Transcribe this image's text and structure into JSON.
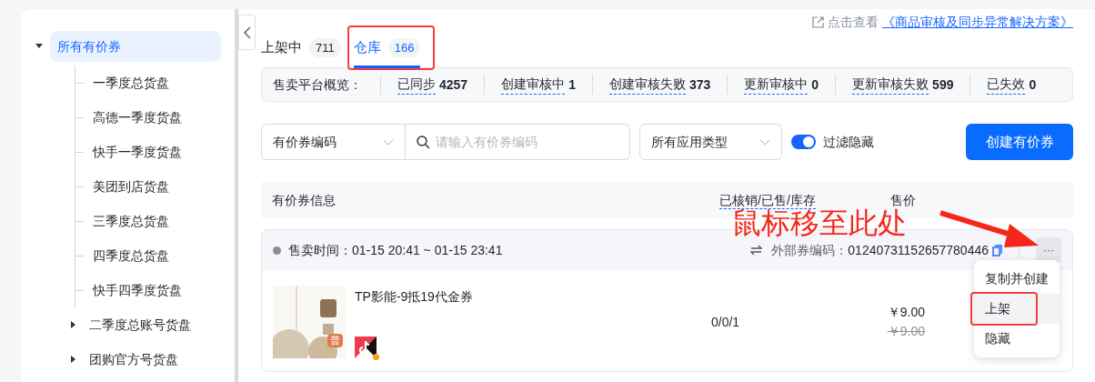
{
  "sidebar": {
    "tree": [
      {
        "label": "所有有价券",
        "selected": true,
        "expanded": true,
        "children": [
          {
            "label": "一季度总货盘",
            "selected": false
          },
          {
            "label": "高德一季度货盘",
            "selected": false
          },
          {
            "label": "快手一季度货盘",
            "selected": false
          },
          {
            "label": "美团到店货盘",
            "selected": false
          },
          {
            "label": "三季度总货盘",
            "selected": false
          },
          {
            "label": "四季度总货盘",
            "selected": false
          },
          {
            "label": "快手四季度货盘",
            "selected": false
          },
          {
            "label": "二季度总账号货盘",
            "selected": false,
            "expanded": false
          },
          {
            "label": "团购官方号货盘",
            "selected": false,
            "expanded": false
          }
        ]
      }
    ]
  },
  "tabs": [
    {
      "label": "上架中",
      "count": "711",
      "selected": false
    },
    {
      "label": "仓库",
      "count": "166",
      "selected": true
    }
  ],
  "help_link": {
    "prefix": "点击查看",
    "link": "《商品审核及同步异常解决方案》"
  },
  "overview": {
    "title": "售卖平台概览：",
    "items": [
      {
        "label": "已同步",
        "value": "4257"
      },
      {
        "label": "创建审核中",
        "value": "1"
      },
      {
        "label": "创建审核失败",
        "value": "373"
      },
      {
        "label": "更新审核中",
        "value": "0"
      },
      {
        "label": "更新审核失败",
        "value": "599"
      },
      {
        "label": "已失效",
        "value": "0"
      }
    ]
  },
  "filters": {
    "code_type": "有价券编码",
    "search": {
      "placeholder": "请输入有价券编码"
    },
    "app_type": "所有应用类型",
    "hide_filter": {
      "label": "过滤隐藏",
      "on": true
    },
    "create_button": "创建有价券"
  },
  "table": {
    "columns": [
      "有价券信息",
      "已核销/已售/库存",
      "售价"
    ],
    "rows": [
      {
        "sale_time": "售卖时间：01-15 20:41 ~ 01-15 23:41",
        "external_code_label": "外部券编码：",
        "external_code": "01240731152657780446",
        "more": "···",
        "title": "TP影能-9抵19代金券",
        "badge": "普",
        "counts": "0/0/1",
        "price": "￥9.00",
        "original_price": "￥9.00",
        "menu": [
          {
            "label": "复制并创建",
            "selected": false
          },
          {
            "label": "上架",
            "selected": true
          },
          {
            "label": "隐藏",
            "selected": false
          }
        ]
      }
    ]
  },
  "annotation": {
    "text": "鼠标移至此处"
  }
}
